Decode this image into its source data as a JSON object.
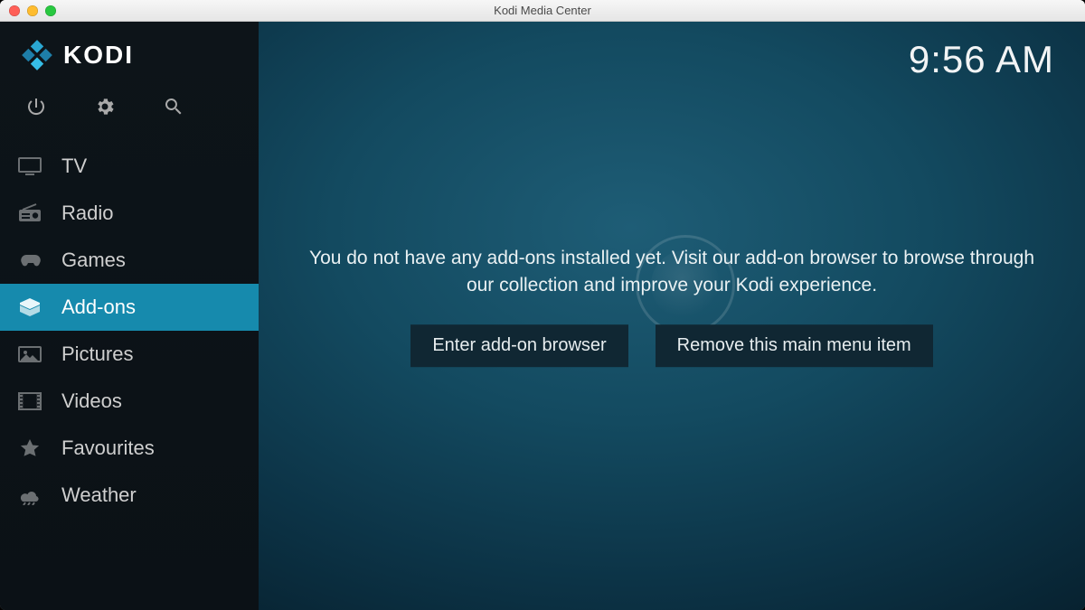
{
  "window": {
    "title": "Kodi Media Center"
  },
  "brand": {
    "name": "KODI"
  },
  "clock": {
    "time": "9:56 AM"
  },
  "system_icons": {
    "power": "power-icon",
    "settings": "gear-icon",
    "search": "search-icon"
  },
  "sidebar": {
    "items": [
      {
        "label": "TV",
        "icon": "tv-icon",
        "active": false
      },
      {
        "label": "Radio",
        "icon": "radio-icon",
        "active": false
      },
      {
        "label": "Games",
        "icon": "gamepad-icon",
        "active": false
      },
      {
        "label": "Add-ons",
        "icon": "box-icon",
        "active": true
      },
      {
        "label": "Pictures",
        "icon": "pictures-icon",
        "active": false
      },
      {
        "label": "Videos",
        "icon": "film-icon",
        "active": false
      },
      {
        "label": "Favourites",
        "icon": "star-icon",
        "active": false
      },
      {
        "label": "Weather",
        "icon": "weather-icon",
        "active": false
      }
    ]
  },
  "main": {
    "message": "You do not have any add-ons installed yet. Visit our add-on browser to browse through our collection and improve your Kodi experience.",
    "buttons": {
      "enter_browser": "Enter add-on browser",
      "remove_item": "Remove this main menu item"
    }
  }
}
